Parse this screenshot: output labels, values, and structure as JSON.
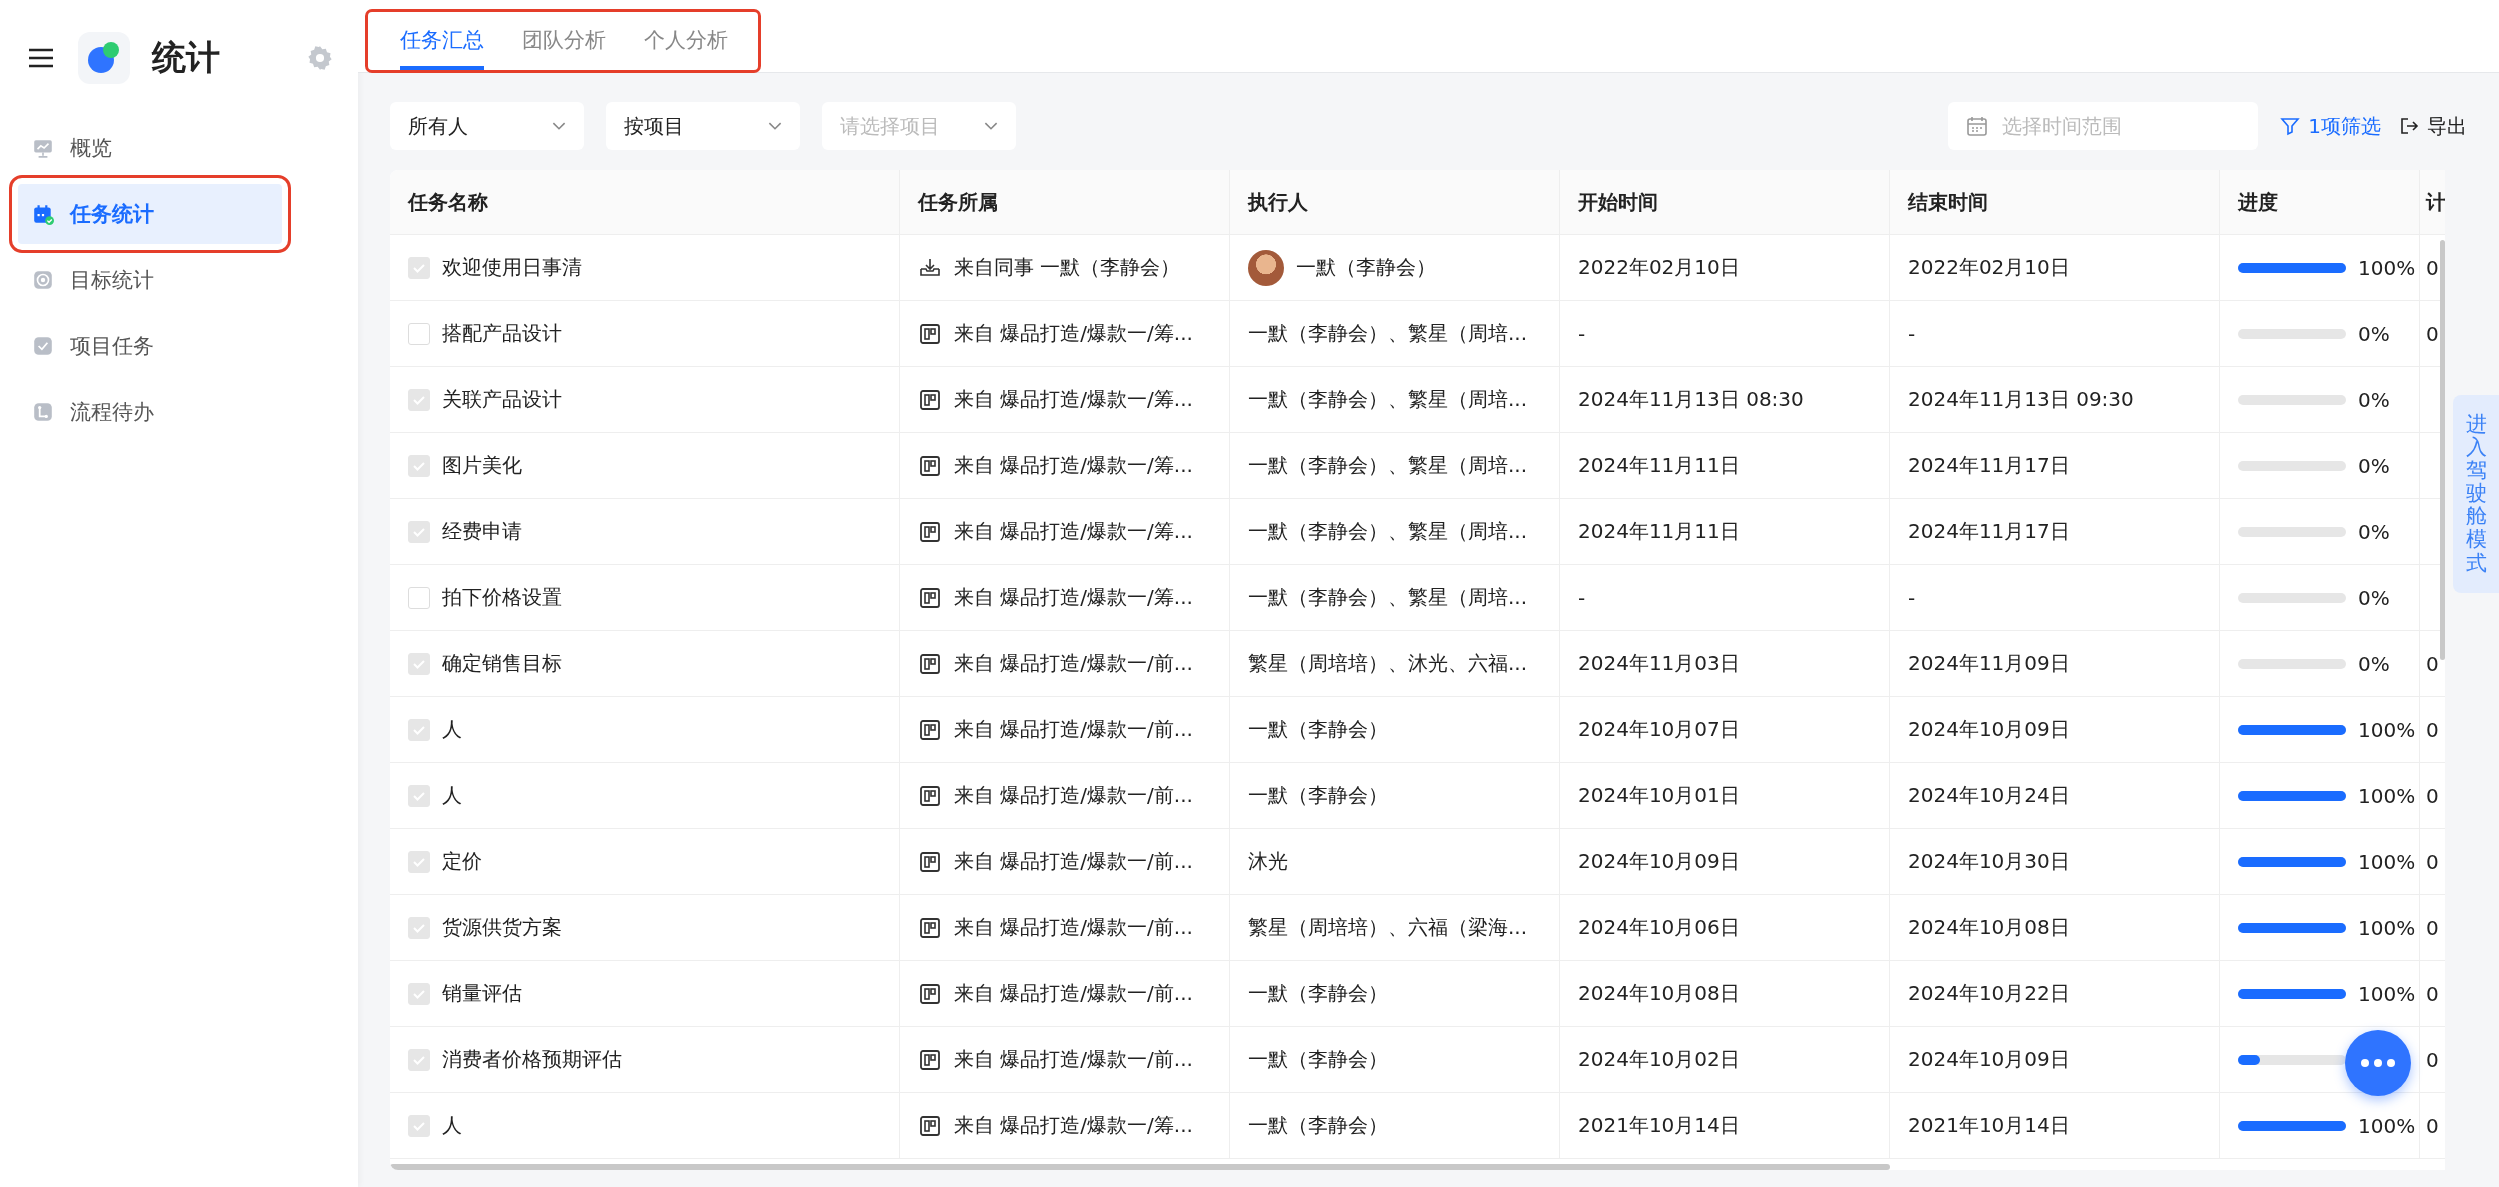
{
  "sidebar": {
    "app_title": "统计",
    "items": [
      {
        "label": "概览",
        "kind": "presentation",
        "selected": false,
        "highlighted": false
      },
      {
        "label": "任务统计",
        "kind": "calendar",
        "selected": true,
        "highlighted": true
      },
      {
        "label": "目标统计",
        "kind": "target",
        "selected": false,
        "highlighted": false
      },
      {
        "label": "项目任务",
        "kind": "check",
        "selected": false,
        "highlighted": false
      },
      {
        "label": "流程待办",
        "kind": "flow",
        "selected": false,
        "highlighted": false
      }
    ]
  },
  "tabs": {
    "highlighted": true,
    "items": [
      {
        "label": "任务汇总",
        "selected": true
      },
      {
        "label": "团队分析",
        "selected": false
      },
      {
        "label": "个人分析",
        "selected": false
      }
    ]
  },
  "filters": {
    "selects": [
      {
        "value": "所有人"
      },
      {
        "value": "按项目"
      },
      {
        "placeholder": "请选择项目"
      }
    ],
    "date_range": {
      "placeholder": "选择时间范围"
    },
    "filter_link": "1项筛选",
    "export": "导出"
  },
  "table": {
    "columns": [
      "任务名称",
      "任务所属",
      "执行人",
      "开始时间",
      "结束时间",
      "进度",
      "计"
    ],
    "rows": [
      {
        "done": true,
        "name": "欢迎使用日事清",
        "kind": "colleague",
        "source": "来自同事 一默（李静会）",
        "avatar": true,
        "assignee": "一默（李静会）",
        "start": "2022年02月10日",
        "end": "2022年02月10日",
        "level": 1,
        "percent": "100%",
        "column_7": "0"
      },
      {
        "done": false,
        "name": "搭配产品设计",
        "kind": "project",
        "source": "来自 爆品打造/爆款一/筹...",
        "avatar": false,
        "assignee": "一默（李静会）、繁星（周培...",
        "start": "-",
        "end": "-",
        "level": 0,
        "percent": "0%",
        "column_7": "0"
      },
      {
        "done": true,
        "name": "关联产品设计",
        "kind": "project",
        "source": "来自 爆品打造/爆款一/筹...",
        "avatar": false,
        "assignee": "一默（李静会）、繁星（周培...",
        "start": "2024年11月13日 08:30",
        "end": "2024年11月13日 09:30",
        "level": 0,
        "percent": "0%"
      },
      {
        "done": true,
        "name": "图片美化",
        "kind": "project",
        "source": "来自 爆品打造/爆款一/筹...",
        "avatar": false,
        "assignee": "一默（李静会）、繁星（周培...",
        "start": "2024年11月11日",
        "end": "2024年11月17日",
        "level": 0,
        "percent": "0%"
      },
      {
        "done": true,
        "name": "经费申请",
        "kind": "project",
        "source": "来自 爆品打造/爆款一/筹...",
        "avatar": false,
        "assignee": "一默（李静会）、繁星（周培...",
        "start": "2024年11月11日",
        "end": "2024年11月17日",
        "level": 0,
        "percent": "0%"
      },
      {
        "done": false,
        "name": "拍下价格设置",
        "kind": "project",
        "source": "来自 爆品打造/爆款一/筹...",
        "avatar": false,
        "assignee": "一默（李静会）、繁星（周培...",
        "start": "-",
        "end": "-",
        "level": 0,
        "percent": "0%"
      },
      {
        "done": true,
        "name": "确定销售目标",
        "kind": "project",
        "source": "来自 爆品打造/爆款一/前...",
        "avatar": false,
        "assignee": "繁星（周培培）、沐光、六福...",
        "start": "2024年11月03日",
        "end": "2024年11月09日",
        "level": 0,
        "percent": "0%",
        "column_7": "0"
      },
      {
        "done": true,
        "name": "人",
        "kind": "project",
        "source": "来自 爆品打造/爆款一/前...",
        "avatar": false,
        "assignee": "一默（李静会）",
        "start": "2024年10月07日",
        "end": "2024年10月09日",
        "level": 1,
        "percent": "100%",
        "column_7": "0"
      },
      {
        "done": true,
        "name": "人",
        "kind": "project",
        "source": "来自 爆品打造/爆款一/前...",
        "avatar": false,
        "assignee": "一默（李静会）",
        "start": "2024年10月01日",
        "end": "2024年10月24日",
        "level": 1,
        "percent": "100%",
        "column_7": "0"
      },
      {
        "done": true,
        "name": "定价",
        "kind": "project",
        "source": "来自 爆品打造/爆款一/前...",
        "avatar": false,
        "assignee": "沐光",
        "start": "2024年10月09日",
        "end": "2024年10月30日",
        "level": 1,
        "percent": "100%",
        "column_7": "0"
      },
      {
        "done": true,
        "name": "货源供货方案",
        "kind": "project",
        "source": "来自 爆品打造/爆款一/前...",
        "avatar": false,
        "assignee": "繁星（周培培）、六福（梁海...",
        "start": "2024年10月06日",
        "end": "2024年10月08日",
        "level": 1,
        "percent": "100%",
        "column_7": "0"
      },
      {
        "done": true,
        "name": "销量评估",
        "kind": "project",
        "source": "来自 爆品打造/爆款一/前...",
        "avatar": false,
        "assignee": "一默（李静会）",
        "start": "2024年10月08日",
        "end": "2024年10月22日",
        "level": 1,
        "percent": "100%",
        "column_7": "0"
      },
      {
        "done": true,
        "name": "消费者价格预期评估",
        "kind": "project",
        "source": "来自 爆品打造/爆款一/前...",
        "avatar": false,
        "assignee": "一默（李静会）",
        "start": "2024年10月02日",
        "end": "2024年10月09日",
        "level": 0.2,
        "column_7": "0"
      },
      {
        "done": true,
        "name": "人",
        "kind": "project",
        "source": "来自 爆品打造/爆款一/筹...",
        "avatar": false,
        "assignee": "一默（李静会）",
        "start": "2021年10月14日",
        "end": "2021年10月14日",
        "level": 1,
        "percent": "100%",
        "column_7": "0"
      }
    ]
  },
  "side_tab": "进入驾驶舱模式"
}
